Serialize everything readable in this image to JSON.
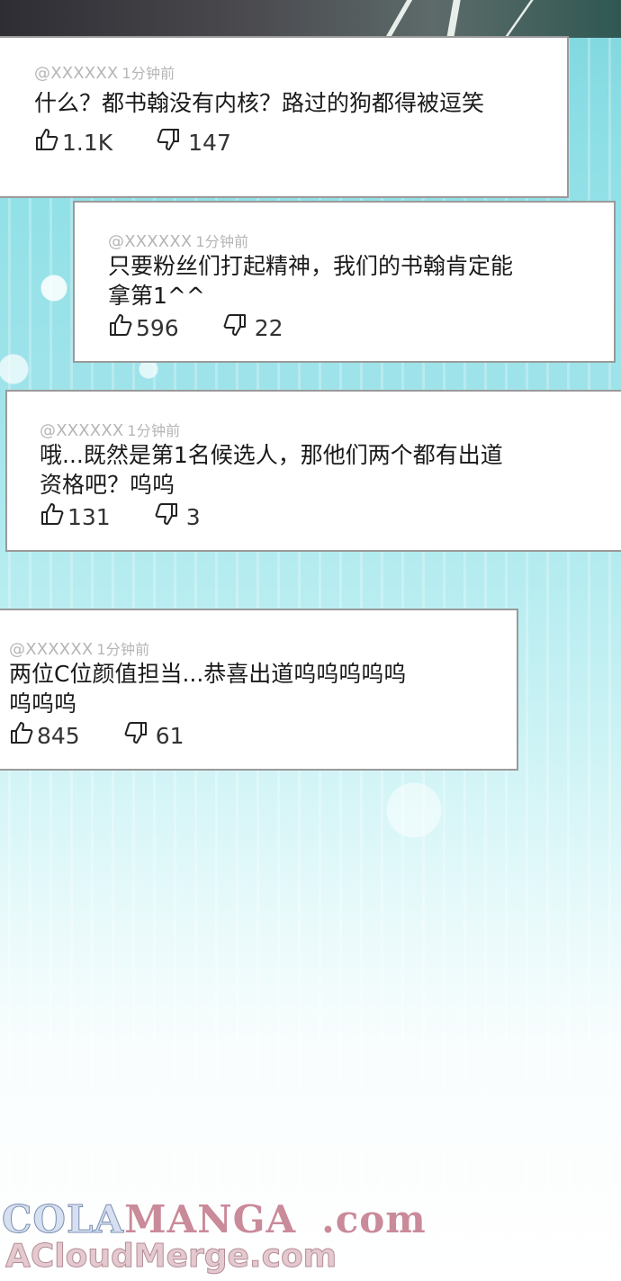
{
  "comments": [
    {
      "user": "@XXXXXX",
      "time": "1分钟前",
      "lines": [
        "什么？都书翰没有内核？路过的狗都得被逗笑"
      ],
      "likes": "1.1K",
      "dislikes": "147"
    },
    {
      "user": "@XXXXXX",
      "time": "1分钟前",
      "lines": [
        "只要粉丝们打起精神，我们的书翰肯定能",
        "拿第1^^"
      ],
      "likes": "596",
      "dislikes": "22"
    },
    {
      "user": "@XXXXXX",
      "time": "1分钟前",
      "lines": [
        "哦...既然是第1名候选人，那他们两个都有出道",
        "资格吧？呜呜"
      ],
      "likes": "131",
      "dislikes": "3"
    },
    {
      "user": "@XXXXXX",
      "time": "1分钟前",
      "lines": [
        "两位C位颜值担当...恭喜出道呜呜呜呜呜",
        "呜呜呜"
      ],
      "likes": "845",
      "dislikes": "61"
    }
  ],
  "watermark": {
    "line1_a": "COLA",
    "line1_b": "MANGA",
    "line1_c": ".com",
    "line2": "ACloudMerge.com"
  },
  "icons": {
    "like": "thumbs-up-icon",
    "dislike": "thumbs-down-icon"
  }
}
